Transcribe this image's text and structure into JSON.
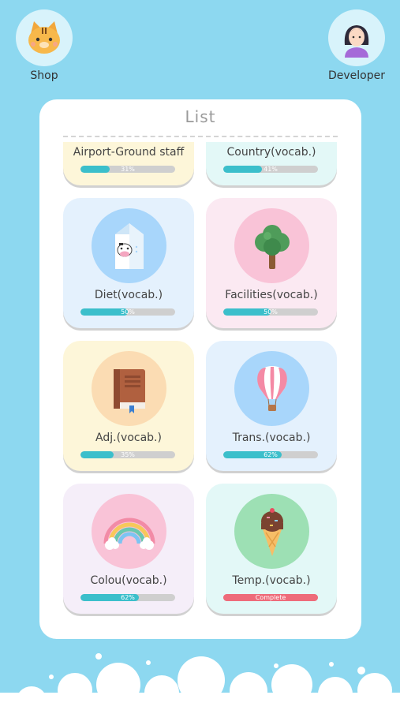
{
  "header": {
    "shop_label": "Shop",
    "developer_label": "Developer"
  },
  "panel": {
    "title": "List"
  },
  "cards": [
    {
      "title": "Airport-Ground staff",
      "progress": 0.31,
      "progress_text": "31%",
      "icon": "airport-icon"
    },
    {
      "title": "Country(vocab.)",
      "progress": 0.41,
      "progress_text": "41%",
      "icon": "globe-icon"
    },
    {
      "title": "Diet(vocab.)",
      "progress": 0.5,
      "progress_text": "50%",
      "icon": "milk-carton-icon"
    },
    {
      "title": "Facilities(vocab.)",
      "progress": 0.5,
      "progress_text": "50%",
      "icon": "tree-icon"
    },
    {
      "title": "Adj.(vocab.)",
      "progress": 0.35,
      "progress_text": "35%",
      "icon": "book-icon"
    },
    {
      "title": "Trans.(vocab.)",
      "progress": 0.62,
      "progress_text": "62%",
      "icon": "hot-air-balloon-icon"
    },
    {
      "title": "Colou(vocab.)",
      "progress": 0.62,
      "progress_text": "62%",
      "icon": "rainbow-icon"
    },
    {
      "title": "Temp.(vocab.)",
      "progress": 1.0,
      "progress_text": "Complete",
      "icon": "ice-cream-icon"
    }
  ],
  "colors": {
    "background": "#8dd8f0",
    "progress": "#3bbfcb",
    "complete": "#ee6b7a"
  }
}
